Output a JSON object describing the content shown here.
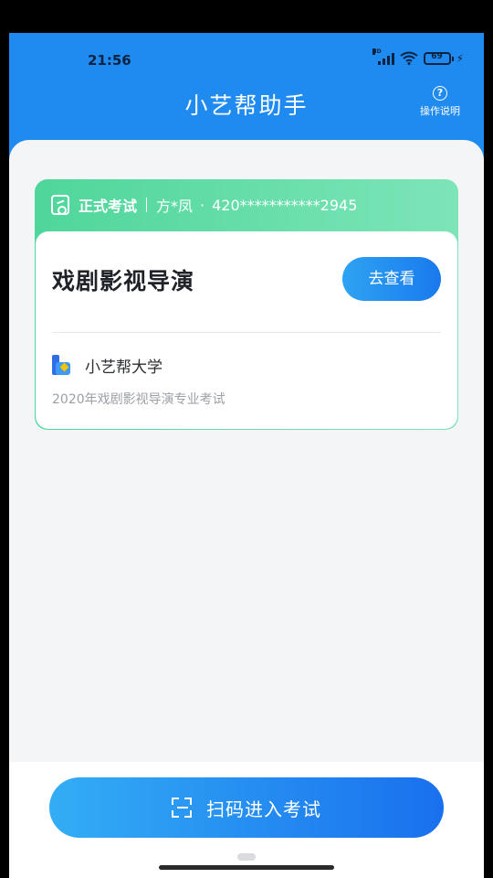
{
  "status_bar": {
    "time": "21:56",
    "battery": "69",
    "network_badge": "HD",
    "icons": [
      "signal-icon",
      "wifi-icon",
      "battery-icon",
      "charging-icon"
    ]
  },
  "header": {
    "title": "小艺帮助手",
    "help_label": "操作说明",
    "help_icon": "question-circle-icon"
  },
  "exam_card": {
    "type": "正式考试",
    "name": "方*凤",
    "dot": "·",
    "id_number": "420***********2945",
    "subject": "戏剧影视导演",
    "view_button": "去查看",
    "school": "小艺帮大学",
    "description": "2020年戏剧影视导演专业考试"
  },
  "footer": {
    "scan_button": "扫码进入考试",
    "scan_icon": "scan-icon"
  },
  "colors": {
    "header_blue": "#1f8af0",
    "card_green": "#4fd69b",
    "button_blue": "#1979ee"
  }
}
